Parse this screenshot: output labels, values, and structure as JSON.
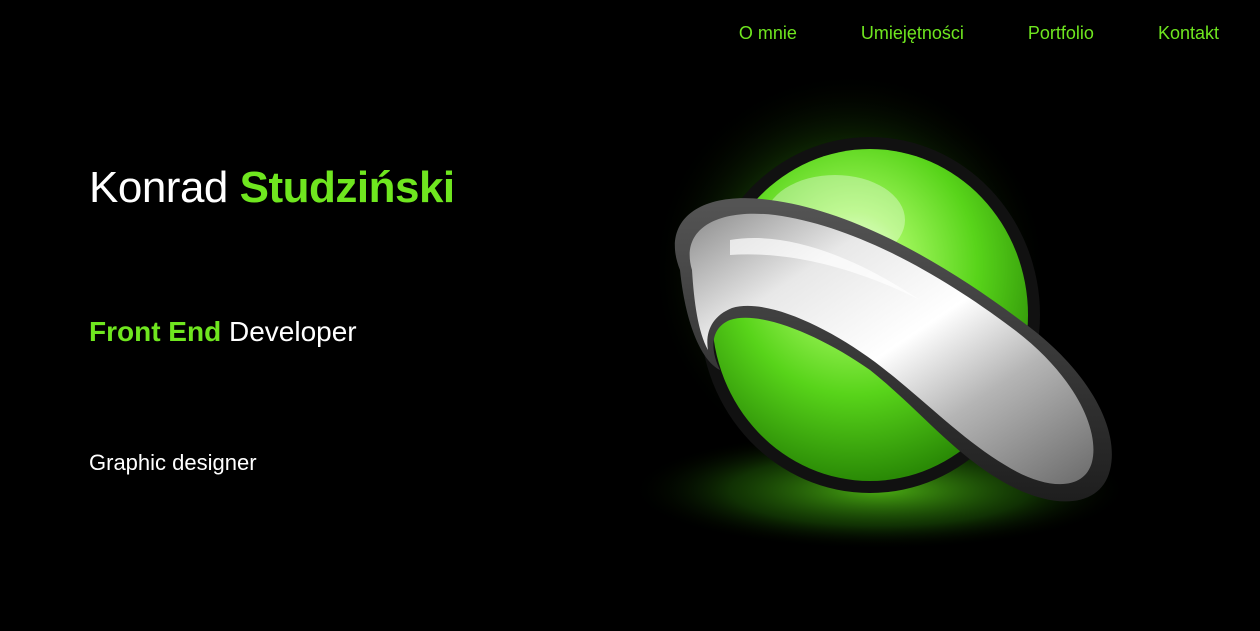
{
  "nav": {
    "items": [
      {
        "label": "O mnie"
      },
      {
        "label": "Umiejętności"
      },
      {
        "label": "Portfolio"
      },
      {
        "label": "Kontakt"
      }
    ]
  },
  "hero": {
    "first_name": "Konrad",
    "last_name": "Studziński",
    "role_accent": "Front End",
    "role_rest": "Developer",
    "subtitle": "Graphic designer"
  },
  "logo": {
    "icon": "green-sphere-ring-logo-icon"
  },
  "colors": {
    "background": "#000000",
    "accent": "#6fe61f",
    "text": "#ffffff"
  }
}
